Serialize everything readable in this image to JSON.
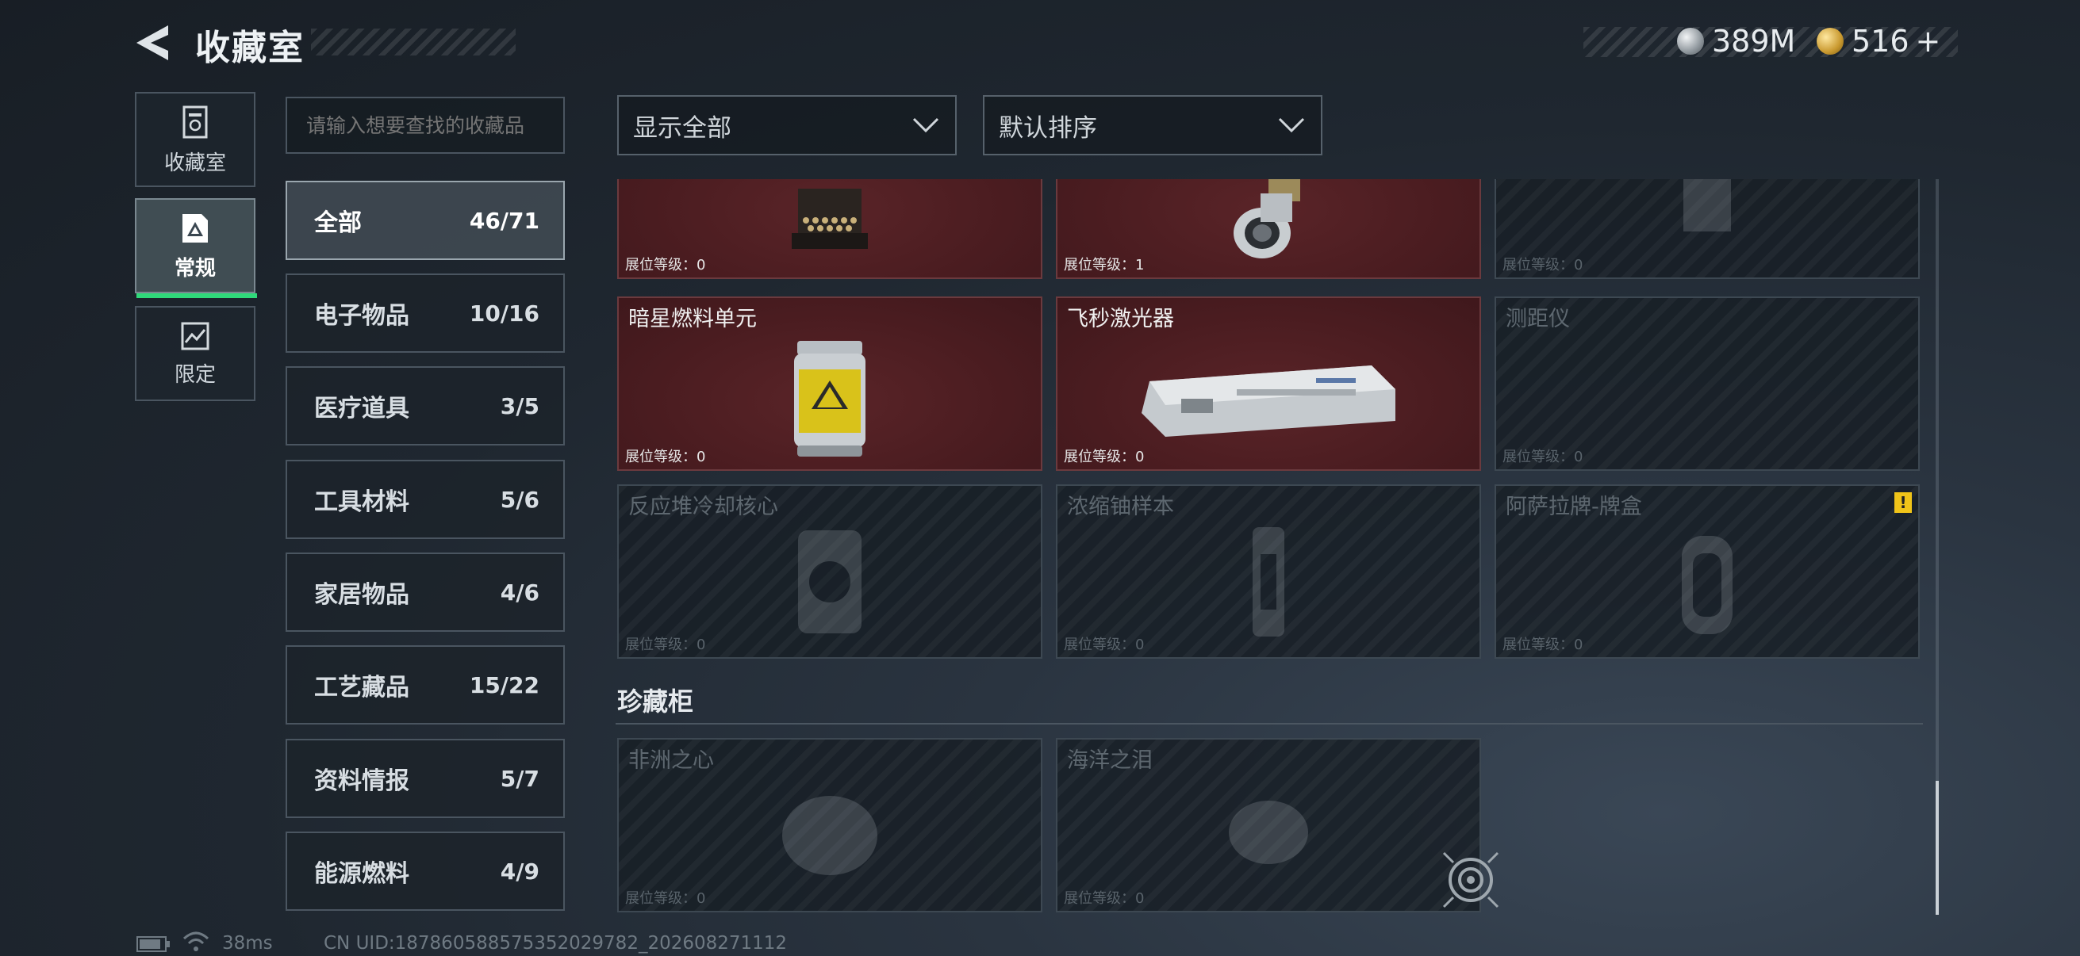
{
  "header": {
    "title": "收藏室",
    "currency": [
      {
        "icon": "silver-coin-icon",
        "value": "389M"
      },
      {
        "icon": "gold-coin-icon",
        "value": "516",
        "plus": "+"
      }
    ]
  },
  "left_tabs": [
    {
      "label": "收藏室",
      "icon": "trash-can-icon",
      "active": false
    },
    {
      "label": "常规",
      "icon": "document-icon",
      "active": true
    },
    {
      "label": "限定",
      "icon": "map-icon",
      "active": false
    }
  ],
  "search": {
    "placeholder": "请输入想要查找的收藏品"
  },
  "categories": [
    {
      "name": "全部",
      "count": "46/71",
      "active": true
    },
    {
      "name": "电子物品",
      "count": "10/16"
    },
    {
      "name": "医疗道具",
      "count": "3/5"
    },
    {
      "name": "工具材料",
      "count": "5/6"
    },
    {
      "name": "家居物品",
      "count": "4/6"
    },
    {
      "name": "工艺藏品",
      "count": "15/22"
    },
    {
      "name": "资料情报",
      "count": "5/7"
    },
    {
      "name": "能源燃料",
      "count": "4/9"
    }
  ],
  "filters": {
    "show": "显示全部",
    "sort": "默认排序"
  },
  "level_prefix": "展位等级：",
  "items": [
    {
      "name": "",
      "level": "0",
      "owned": true
    },
    {
      "name": "",
      "level": "1",
      "owned": true
    },
    {
      "name": "",
      "level": "0",
      "owned": false
    },
    {
      "name": "暗星燃料单元",
      "level": "0",
      "owned": true
    },
    {
      "name": "飞秒激光器",
      "level": "0",
      "owned": true
    },
    {
      "name": "测距仪",
      "level": "0",
      "owned": false
    },
    {
      "name": "反应堆冷却核心",
      "level": "0",
      "owned": false
    },
    {
      "name": "浓缩铀样本",
      "level": "0",
      "owned": false
    },
    {
      "name": "阿萨拉牌-牌盒",
      "level": "0",
      "owned": false,
      "warning": "!"
    }
  ],
  "section": {
    "title": "珍藏柜"
  },
  "treasures": [
    {
      "name": "非洲之心",
      "level": "0",
      "owned": false
    },
    {
      "name": "海洋之泪",
      "level": "0",
      "owned": false
    }
  ],
  "footer": {
    "ping": "38ms",
    "uid": "CN UID:187860588575352029782_202608271112"
  },
  "colors": {
    "accent": "#2fd97a",
    "owned_bg": "#4a1c20",
    "warning": "#f0c419"
  }
}
